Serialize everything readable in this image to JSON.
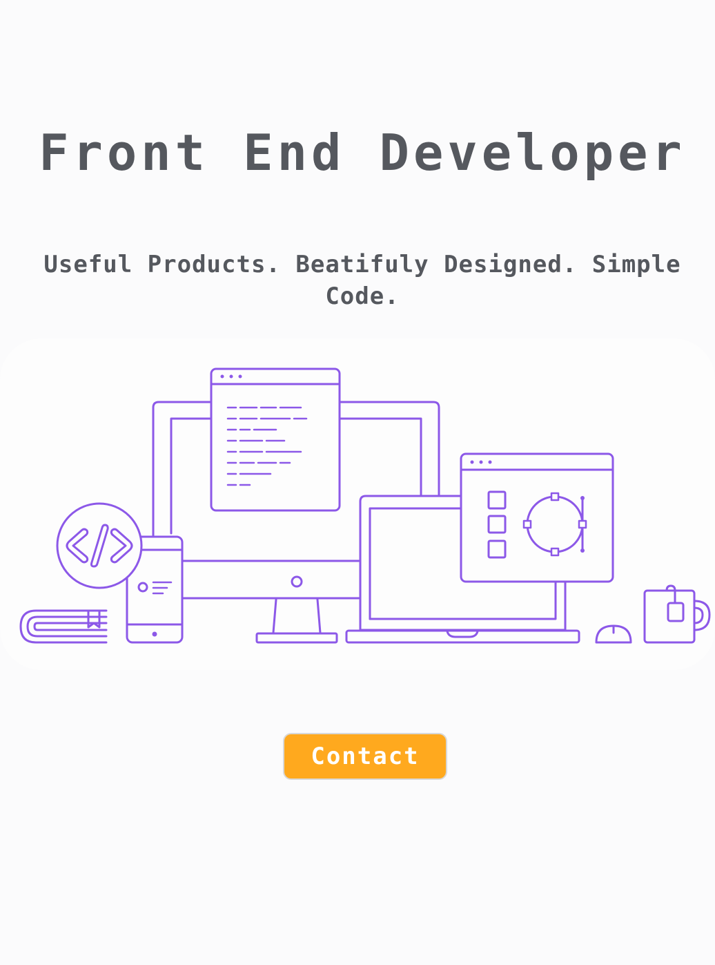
{
  "hero": {
    "title": "Front End Developer",
    "tagline": "Useful Products. Beatifuly Designed. Simple Code."
  },
  "illustration": {
    "items": [
      "monitor",
      "code-window",
      "design-window",
      "laptop",
      "phone",
      "code-badge-icon",
      "book",
      "mouse",
      "mug"
    ],
    "stroke_color": "#8c58e8"
  },
  "contact": {
    "label": "Contact",
    "color": "#ffa91e"
  }
}
